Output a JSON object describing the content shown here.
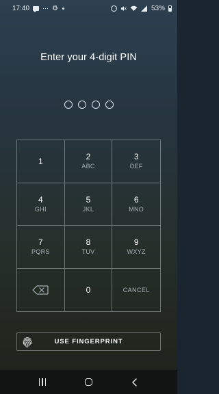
{
  "status_bar": {
    "time": "17:40",
    "battery_percent": "53%",
    "battery_level": 0.53,
    "left_icons": [
      "message-icon",
      "dots-icon",
      "gear-icon",
      "notification-dot-icon"
    ],
    "right_icons": [
      "alarm-icon",
      "mute-icon",
      "wifi-icon",
      "signal-icon",
      "battery-icon"
    ]
  },
  "pin_screen": {
    "title": "Enter your 4-digit PIN",
    "digits_total": 4,
    "digits_entered": 0
  },
  "keypad": {
    "keys": [
      {
        "number": "1",
        "letters": ""
      },
      {
        "number": "2",
        "letters": "ABC"
      },
      {
        "number": "3",
        "letters": "DEF"
      },
      {
        "number": "4",
        "letters": "GHI"
      },
      {
        "number": "5",
        "letters": "JKL"
      },
      {
        "number": "6",
        "letters": "MNO"
      },
      {
        "number": "7",
        "letters": "PQRS"
      },
      {
        "number": "8",
        "letters": "TUV"
      },
      {
        "number": "9",
        "letters": "WXYZ"
      }
    ],
    "backspace_icon": "backspace-icon",
    "zero": "0",
    "cancel_label": "CANCEL"
  },
  "fingerprint": {
    "label": "USE FINGERPRINT",
    "icon": "fingerprint-icon"
  },
  "nav_bar": {
    "icons": [
      "recents-icon",
      "home-icon",
      "back-icon"
    ]
  },
  "colors": {
    "background_top": "#2d4050",
    "background_bottom": "#1d201b",
    "grid_line": "#c8d2d7",
    "secondary_text": "#a9b2b8",
    "nav_bar": "#121414"
  }
}
